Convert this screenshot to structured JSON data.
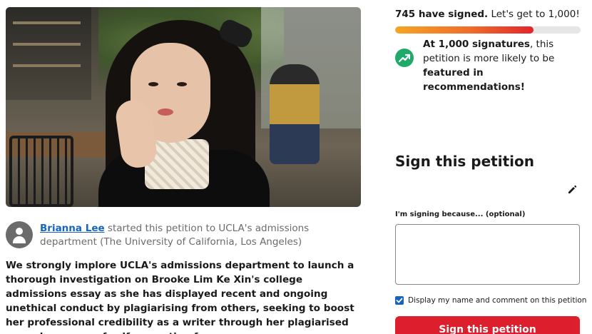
{
  "petition": {
    "starter": {
      "name": "Brianna Lee",
      "action": " started this petition to UCLA's admissions department (The University of California, Los Angeles)"
    },
    "description": "We strongly implore UCLA's admissions department to launch a thorough investigation on Brooke Lim Ke Xin's college admissions essay as she has displayed recent and ongoing unethical conduct by plagiarising from others, seeking to boost her professional credibility as a writer through her plagiarised essay by means of self-promotion for"
  },
  "progress": {
    "signed_count": "745 have signed.",
    "goal_text": " Let's get to 1,000!",
    "fraction": 0.745
  },
  "milestone": {
    "part1": "At 1,000 signatures",
    "part2": ", this petition is more likely to be ",
    "part3": "featured in recommendations!",
    "icon": "trending-up-icon"
  },
  "sign_form": {
    "title": "Sign this petition",
    "reason_label": "I'm signing because... (optional)",
    "reason_value": "",
    "display_label": "Display my name and comment on this petition",
    "display_checked": true,
    "button_label": "Sign this petition"
  },
  "colors": {
    "accent_red": "#dc1e2d",
    "link_blue": "#1565c0",
    "trend_green": "#1faa6a"
  }
}
